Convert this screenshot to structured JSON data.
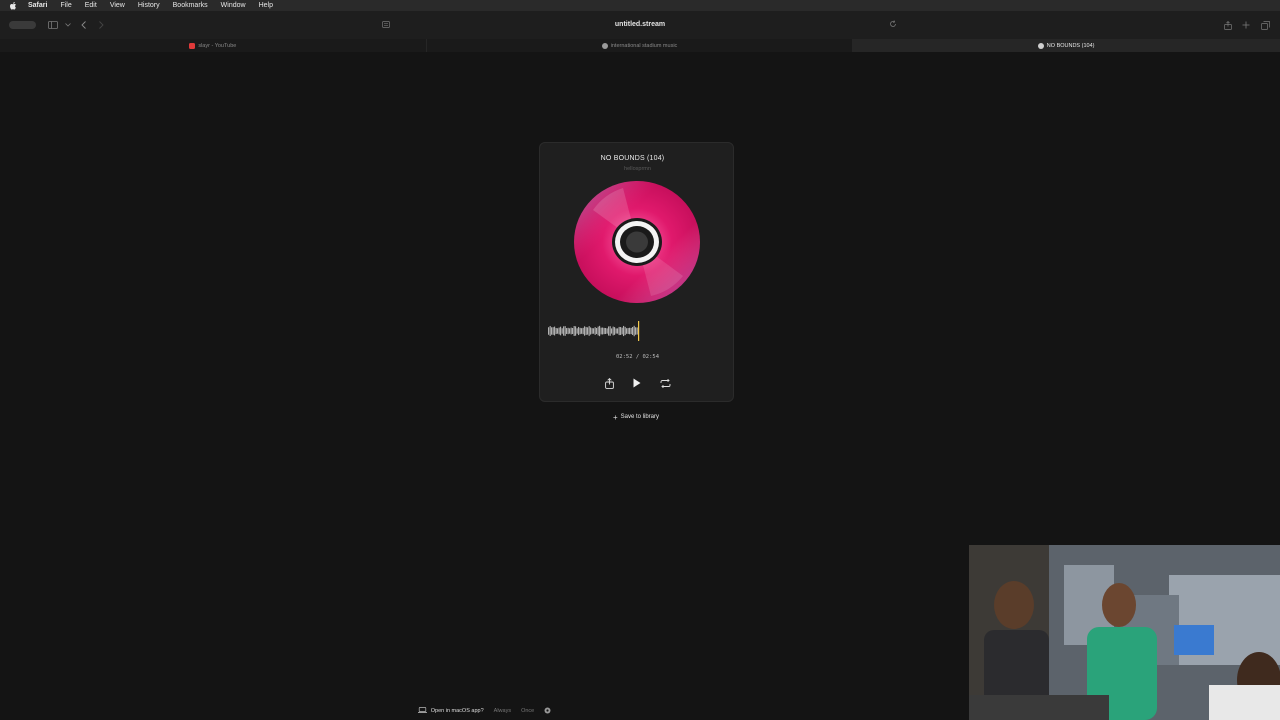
{
  "menubar": {
    "app": "Safari",
    "items": [
      "File",
      "Edit",
      "View",
      "History",
      "Bookmarks",
      "Window",
      "Help"
    ]
  },
  "toolbar": {
    "address": "untitled.stream"
  },
  "tabs": [
    {
      "label": "slayr - YouTube",
      "active": false,
      "favicon_color": "#e03a3a"
    },
    {
      "label": "international stadium music",
      "active": false,
      "favicon_color": "#8a8a8a"
    },
    {
      "label": "NO BOUNDS (104)",
      "active": true,
      "favicon_color": "#cfcfcf"
    }
  ],
  "player": {
    "title": "NO BOUNDS (104)",
    "artist": "hellosprmn",
    "elapsed": "02:52",
    "separator": "/",
    "duration": "02:54",
    "progress": 0.988,
    "playhead_color": "#f2c94c",
    "disc_color": "#e0196c"
  },
  "save": {
    "label": "Save to library"
  },
  "bottombar": {
    "open_app": "Open in macOS app?",
    "always": "Always",
    "once": "Once"
  }
}
